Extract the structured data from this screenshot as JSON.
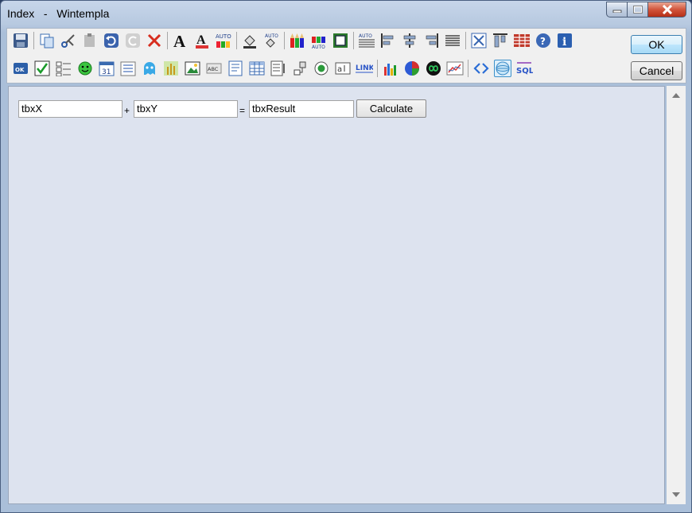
{
  "window": {
    "title": "Index   -   Wintempla",
    "controls": [
      "minimize-icon",
      "maximize-icon",
      "close-icon"
    ]
  },
  "toolbar": {
    "row1": [
      "save-icon",
      "copy-icon",
      "cut-icon",
      "paste-icon",
      "undo-icon",
      "redo-icon",
      "delete-icon",
      "|",
      "font-icon",
      "font-color-icon",
      "auto-color-icon",
      "|",
      "fill-color-icon",
      "auto-fill-icon",
      "|",
      "pencils-icon",
      "auto-pencils-icon",
      "border-icon",
      "|",
      "auto-align-icon",
      "align-left-icon",
      "align-center-icon",
      "align-right-icon",
      "justify-icon",
      "|",
      "expand-icon",
      "align-top-icon",
      "grid-icon",
      "help-icon",
      "info-icon"
    ],
    "row2": [
      "button-control-icon",
      "checkbox-icon",
      "checklist-icon",
      "smiley-icon",
      "calendar-icon",
      "listview-icon",
      "ghost-icon",
      "image-wheat-icon",
      "picture-icon",
      "abc-label-icon",
      "textbox-icon",
      "table-icon",
      "tree-icon",
      "hierarchy-icon",
      "radio-icon",
      "textfield-icon",
      "link-icon",
      "|",
      "bar-chart-icon",
      "pie-chart-icon",
      "infinity-icon",
      "line-chart-icon",
      "|",
      "code-icon",
      "web-icon",
      "sql-icon"
    ],
    "link_text": "LINK",
    "sql_text": "SQL",
    "auto_text": "AUTO",
    "calendar_text": "31",
    "abc_text": "ABC",
    "ok_text": "OK",
    "selected_icon": "web-icon"
  },
  "dialog_buttons": {
    "ok_label": "OK",
    "cancel_label": "Cancel"
  },
  "form": {
    "x_field": "tbxX",
    "plus": "+",
    "y_field": "tbxY",
    "equals": "=",
    "result_field": "tbxResult",
    "calculate_label": "Calculate"
  }
}
